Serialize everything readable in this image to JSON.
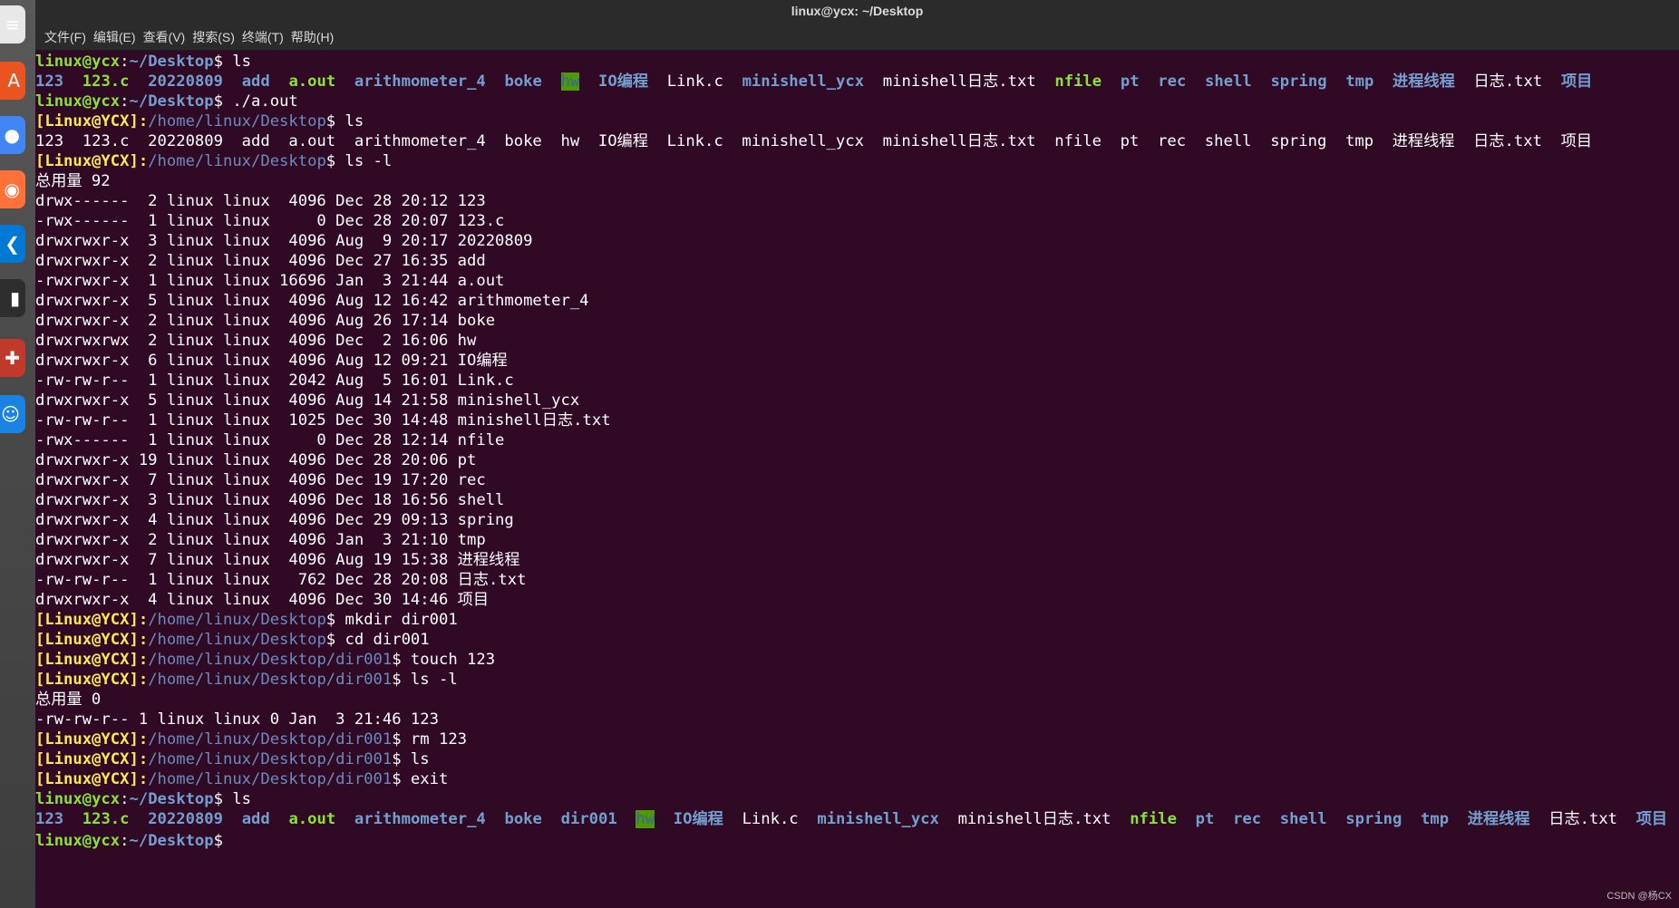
{
  "window": {
    "title": "linux@ycx: ~/Desktop",
    "menu": [
      "文件(F)",
      "编辑(E)",
      "查看(V)",
      "搜索(S)",
      "终端(T)",
      "帮助(H)"
    ]
  },
  "terminal_lines": [
    {
      "segs": [
        {
          "t": "linux@ycx",
          "c": "u"
        },
        {
          "t": ":",
          "c": ""
        },
        {
          "t": "~/Desktop",
          "c": "p"
        },
        {
          "t": "$ ls",
          "c": ""
        }
      ]
    },
    {
      "segs": [
        {
          "t": "123",
          "c": "dir"
        },
        {
          "t": "  ",
          "c": ""
        },
        {
          "t": "123.c",
          "c": "exe"
        },
        {
          "t": "  ",
          "c": ""
        },
        {
          "t": "20220809",
          "c": "dir"
        },
        {
          "t": "  ",
          "c": ""
        },
        {
          "t": "add",
          "c": "dir"
        },
        {
          "t": "  ",
          "c": ""
        },
        {
          "t": "a.out",
          "c": "exe"
        },
        {
          "t": "  ",
          "c": ""
        },
        {
          "t": "arithmometer_4",
          "c": "dir"
        },
        {
          "t": "  ",
          "c": ""
        },
        {
          "t": "boke",
          "c": "dir"
        },
        {
          "t": "  ",
          "c": ""
        },
        {
          "t": "hw",
          "c": "ow"
        },
        {
          "t": "  ",
          "c": ""
        },
        {
          "t": "IO编程",
          "c": "dir"
        },
        {
          "t": "  Link.c  ",
          "c": ""
        },
        {
          "t": "minishell_ycx",
          "c": "dir"
        },
        {
          "t": "  minishell日志.txt  ",
          "c": ""
        },
        {
          "t": "nfile",
          "c": "exe"
        },
        {
          "t": "  ",
          "c": ""
        },
        {
          "t": "pt",
          "c": "dir"
        },
        {
          "t": "  ",
          "c": ""
        },
        {
          "t": "rec",
          "c": "dir"
        },
        {
          "t": "  ",
          "c": ""
        },
        {
          "t": "shell",
          "c": "dir"
        },
        {
          "t": "  ",
          "c": ""
        },
        {
          "t": "spring",
          "c": "dir"
        },
        {
          "t": "  ",
          "c": ""
        },
        {
          "t": "tmp",
          "c": "dir"
        },
        {
          "t": "  ",
          "c": ""
        },
        {
          "t": "进程线程",
          "c": "dir"
        },
        {
          "t": "  日志.txt  ",
          "c": ""
        },
        {
          "t": "项目",
          "c": "dir"
        }
      ]
    },
    {
      "segs": [
        {
          "t": "linux@ycx",
          "c": "u"
        },
        {
          "t": ":",
          "c": ""
        },
        {
          "t": "~/Desktop",
          "c": "p"
        },
        {
          "t": "$ ./a.out",
          "c": ""
        }
      ]
    },
    {
      "segs": [
        {
          "t": "[Linux@YCX]:",
          "c": "ux"
        },
        {
          "t": "/home/linux/Desktop",
          "c": "pd"
        },
        {
          "t": "$ ls",
          "c": ""
        }
      ]
    },
    {
      "segs": [
        {
          "t": "123  123.c  20220809  add  a.out  arithmometer_4  boke  hw  IO编程  Link.c  minishell_ycx  minishell日志.txt  nfile  pt  rec  shell  spring  tmp  进程线程  日志.txt  项目",
          "c": ""
        }
      ]
    },
    {
      "segs": [
        {
          "t": "[Linux@YCX]:",
          "c": "ux"
        },
        {
          "t": "/home/linux/Desktop",
          "c": "pd"
        },
        {
          "t": "$ ls -l",
          "c": ""
        }
      ]
    },
    {
      "segs": [
        {
          "t": "总用量 92",
          "c": ""
        }
      ]
    },
    {
      "segs": [
        {
          "t": "drwx------  2 linux linux  4096 Dec 28 20:12 123",
          "c": ""
        }
      ]
    },
    {
      "segs": [
        {
          "t": "-rwx------  1 linux linux     0 Dec 28 20:07 123.c",
          "c": ""
        }
      ]
    },
    {
      "segs": [
        {
          "t": "drwxrwxr-x  3 linux linux  4096 Aug  9 20:17 20220809",
          "c": ""
        }
      ]
    },
    {
      "segs": [
        {
          "t": "drwxrwxr-x  2 linux linux  4096 Dec 27 16:35 add",
          "c": ""
        }
      ]
    },
    {
      "segs": [
        {
          "t": "-rwxrwxr-x  1 linux linux 16696 Jan  3 21:44 a.out",
          "c": ""
        }
      ]
    },
    {
      "segs": [
        {
          "t": "drwxrwxr-x  5 linux linux  4096 Aug 12 16:42 arithmometer_4",
          "c": ""
        }
      ]
    },
    {
      "segs": [
        {
          "t": "drwxrwxr-x  2 linux linux  4096 Aug 26 17:14 boke",
          "c": ""
        }
      ]
    },
    {
      "segs": [
        {
          "t": "drwxrwxrwx  2 linux linux  4096 Dec  2 16:06 hw",
          "c": ""
        }
      ]
    },
    {
      "segs": [
        {
          "t": "drwxrwxr-x  6 linux linux  4096 Aug 12 09:21 IO编程",
          "c": ""
        }
      ]
    },
    {
      "segs": [
        {
          "t": "-rw-rw-r--  1 linux linux  2042 Aug  5 16:01 Link.c",
          "c": ""
        }
      ]
    },
    {
      "segs": [
        {
          "t": "drwxrwxr-x  5 linux linux  4096 Aug 14 21:58 minishell_ycx",
          "c": ""
        }
      ]
    },
    {
      "segs": [
        {
          "t": "-rw-rw-r--  1 linux linux  1025 Dec 30 14:48 minishell日志.txt",
          "c": ""
        }
      ]
    },
    {
      "segs": [
        {
          "t": "-rwx------  1 linux linux     0 Dec 28 12:14 nfile",
          "c": ""
        }
      ]
    },
    {
      "segs": [
        {
          "t": "drwxrwxr-x 19 linux linux  4096 Dec 28 20:06 pt",
          "c": ""
        }
      ]
    },
    {
      "segs": [
        {
          "t": "drwxrwxr-x  7 linux linux  4096 Dec 19 17:20 rec",
          "c": ""
        }
      ]
    },
    {
      "segs": [
        {
          "t": "drwxrwxr-x  3 linux linux  4096 Dec 18 16:56 shell",
          "c": ""
        }
      ]
    },
    {
      "segs": [
        {
          "t": "drwxrwxr-x  4 linux linux  4096 Dec 29 09:13 spring",
          "c": ""
        }
      ]
    },
    {
      "segs": [
        {
          "t": "drwxrwxr-x  2 linux linux  4096 Jan  3 21:10 tmp",
          "c": ""
        }
      ]
    },
    {
      "segs": [
        {
          "t": "drwxrwxr-x  7 linux linux  4096 Aug 19 15:38 进程线程",
          "c": ""
        }
      ]
    },
    {
      "segs": [
        {
          "t": "-rw-rw-r--  1 linux linux   762 Dec 28 20:08 日志.txt",
          "c": ""
        }
      ]
    },
    {
      "segs": [
        {
          "t": "drwxrwxr-x  4 linux linux  4096 Dec 30 14:46 项目",
          "c": ""
        }
      ]
    },
    {
      "segs": [
        {
          "t": "[Linux@YCX]:",
          "c": "ux"
        },
        {
          "t": "/home/linux/Desktop",
          "c": "pd"
        },
        {
          "t": "$ mkdir dir001",
          "c": ""
        }
      ]
    },
    {
      "segs": [
        {
          "t": "[Linux@YCX]:",
          "c": "ux"
        },
        {
          "t": "/home/linux/Desktop",
          "c": "pd"
        },
        {
          "t": "$ cd dir001",
          "c": ""
        }
      ]
    },
    {
      "segs": [
        {
          "t": "[Linux@YCX]:",
          "c": "ux"
        },
        {
          "t": "/home/linux/Desktop/dir001",
          "c": "pd"
        },
        {
          "t": "$ touch 123",
          "c": ""
        }
      ]
    },
    {
      "segs": [
        {
          "t": "[Linux@YCX]:",
          "c": "ux"
        },
        {
          "t": "/home/linux/Desktop/dir001",
          "c": "pd"
        },
        {
          "t": "$ ls -l",
          "c": ""
        }
      ]
    },
    {
      "segs": [
        {
          "t": "总用量 0",
          "c": ""
        }
      ]
    },
    {
      "segs": [
        {
          "t": "-rw-rw-r-- 1 linux linux 0 Jan  3 21:46 123",
          "c": ""
        }
      ]
    },
    {
      "segs": [
        {
          "t": "[Linux@YCX]:",
          "c": "ux"
        },
        {
          "t": "/home/linux/Desktop/dir001",
          "c": "pd"
        },
        {
          "t": "$ rm 123",
          "c": ""
        }
      ]
    },
    {
      "segs": [
        {
          "t": "[Linux@YCX]:",
          "c": "ux"
        },
        {
          "t": "/home/linux/Desktop/dir001",
          "c": "pd"
        },
        {
          "t": "$ ls",
          "c": ""
        }
      ]
    },
    {
      "segs": [
        {
          "t": "[Linux@YCX]:",
          "c": "ux"
        },
        {
          "t": "/home/linux/Desktop/dir001",
          "c": "pd"
        },
        {
          "t": "$ exit",
          "c": ""
        }
      ]
    },
    {
      "segs": [
        {
          "t": "linux@ycx",
          "c": "u"
        },
        {
          "t": ":",
          "c": ""
        },
        {
          "t": "~/Desktop",
          "c": "p"
        },
        {
          "t": "$ ls",
          "c": ""
        }
      ]
    },
    {
      "segs": [
        {
          "t": "123",
          "c": "dir"
        },
        {
          "t": "  ",
          "c": ""
        },
        {
          "t": "123.c",
          "c": "exe"
        },
        {
          "t": "  ",
          "c": ""
        },
        {
          "t": "20220809",
          "c": "dir"
        },
        {
          "t": "  ",
          "c": ""
        },
        {
          "t": "add",
          "c": "dir"
        },
        {
          "t": "  ",
          "c": ""
        },
        {
          "t": "a.out",
          "c": "exe"
        },
        {
          "t": "  ",
          "c": ""
        },
        {
          "t": "arithmometer_4",
          "c": "dir"
        },
        {
          "t": "  ",
          "c": ""
        },
        {
          "t": "boke",
          "c": "dir"
        },
        {
          "t": "  ",
          "c": ""
        },
        {
          "t": "dir001",
          "c": "dir"
        },
        {
          "t": "  ",
          "c": ""
        },
        {
          "t": "hw",
          "c": "ow"
        },
        {
          "t": "  ",
          "c": ""
        },
        {
          "t": "IO编程",
          "c": "dir"
        },
        {
          "t": "  Link.c  ",
          "c": ""
        },
        {
          "t": "minishell_ycx",
          "c": "dir"
        },
        {
          "t": "  minishell日志.txt  ",
          "c": ""
        },
        {
          "t": "nfile",
          "c": "exe"
        },
        {
          "t": "  ",
          "c": ""
        },
        {
          "t": "pt",
          "c": "dir"
        },
        {
          "t": "  ",
          "c": ""
        },
        {
          "t": "rec",
          "c": "dir"
        },
        {
          "t": "  ",
          "c": ""
        },
        {
          "t": "shell",
          "c": "dir"
        },
        {
          "t": "  ",
          "c": ""
        },
        {
          "t": "spring",
          "c": "dir"
        },
        {
          "t": "  ",
          "c": ""
        },
        {
          "t": "tmp",
          "c": "dir"
        },
        {
          "t": "  ",
          "c": ""
        },
        {
          "t": "进程线程",
          "c": "dir"
        },
        {
          "t": "  日志.txt  ",
          "c": ""
        },
        {
          "t": "项目",
          "c": "dir"
        }
      ]
    },
    {
      "segs": [
        {
          "t": "linux@ycx",
          "c": "u"
        },
        {
          "t": ":",
          "c": ""
        },
        {
          "t": "~/Desktop",
          "c": "p"
        },
        {
          "t": "$ ",
          "c": ""
        }
      ]
    }
  ],
  "dock": [
    {
      "name": "text-editor-icon",
      "glyph": "≡",
      "color": "#e8e8e8"
    },
    {
      "name": "software-center-icon",
      "glyph": "A",
      "color": "#e95420"
    },
    {
      "name": "chrome-icon",
      "glyph": "●",
      "color": "#4285f4"
    },
    {
      "name": "firefox-icon",
      "glyph": "◉",
      "color": "#ff7139"
    },
    {
      "name": "vscode-icon",
      "glyph": "❮",
      "color": "#0078d4"
    },
    {
      "name": "terminal-icon",
      "glyph": "▮",
      "color": "#2d2d2d"
    },
    {
      "name": "settings-icon",
      "glyph": "✚",
      "color": "#c0392b"
    },
    {
      "name": "finder-icon",
      "glyph": "☺",
      "color": "#1a82e2"
    }
  ],
  "watermark": "CSDN @杨CX"
}
